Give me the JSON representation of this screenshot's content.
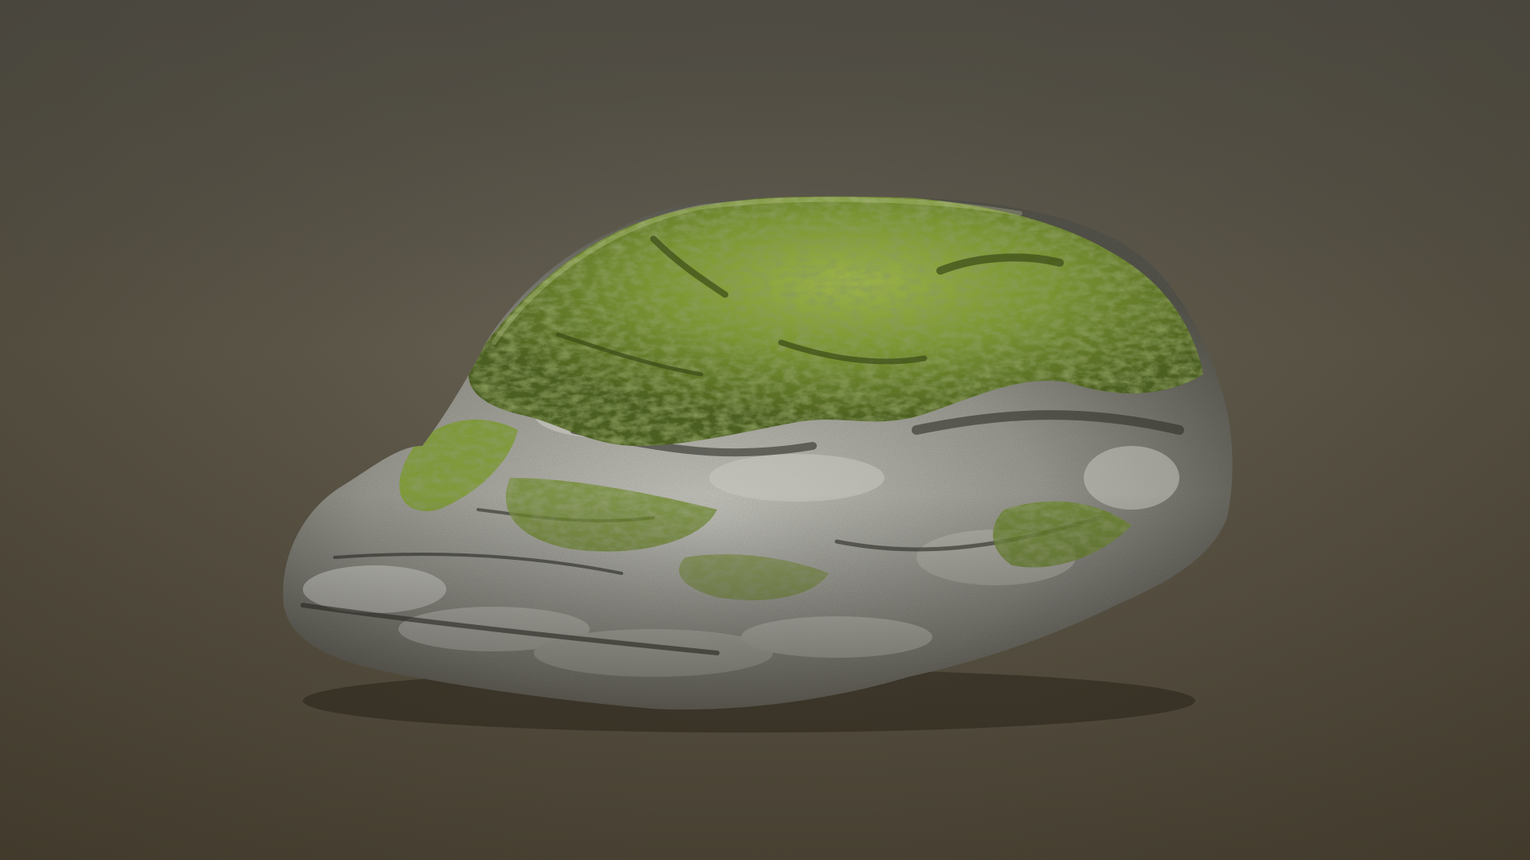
{
  "scene": {
    "subject_icon": "moss-rock-icon",
    "colors": {
      "background_top": "#4f4e4a",
      "background_bottom": "#4a4030",
      "moss_light": "#9cb34a",
      "moss_mid": "#6f8a2c",
      "moss_dark": "#3e4e1a",
      "stone_light": "#d8d8d2",
      "stone_mid": "#9a9a92",
      "stone_dark": "#4a4a44"
    }
  }
}
